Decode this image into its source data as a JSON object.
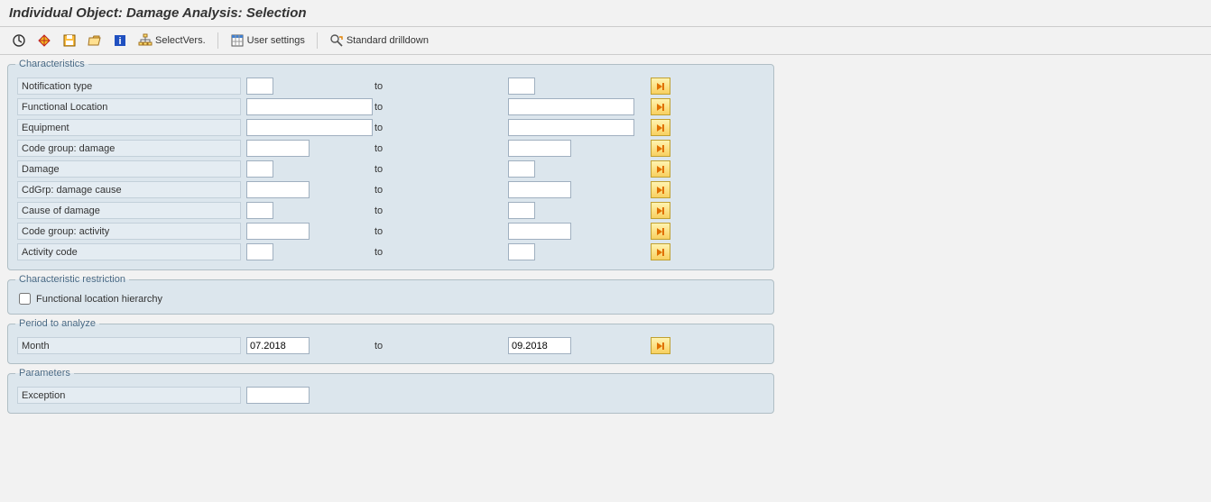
{
  "title": "Individual Object: Damage Analysis: Selection",
  "toolbar": {
    "select_vers": "SelectVers.",
    "user_settings": "User settings",
    "standard_drilldown": "Standard drilldown"
  },
  "panels": {
    "characteristics": {
      "title": "Characteristics",
      "to_label": "to",
      "rows": [
        {
          "label": "Notification type",
          "from": "",
          "to": "",
          "size": "tiny"
        },
        {
          "label": "Functional Location",
          "from": "",
          "to": "",
          "size": "md"
        },
        {
          "label": "Equipment",
          "from": "",
          "to": "",
          "size": "md"
        },
        {
          "label": "Code group: damage",
          "from": "",
          "to": "",
          "size": "sm"
        },
        {
          "label": "Damage",
          "from": "",
          "to": "",
          "size": "tiny"
        },
        {
          "label": "CdGrp: damage cause",
          "from": "",
          "to": "",
          "size": "sm"
        },
        {
          "label": "Cause of damage",
          "from": "",
          "to": "",
          "size": "tiny"
        },
        {
          "label": "Code group: activity",
          "from": "",
          "to": "",
          "size": "sm"
        },
        {
          "label": "Activity code",
          "from": "",
          "to": "",
          "size": "tiny"
        }
      ]
    },
    "restriction": {
      "title": "Characteristic restriction",
      "checkbox_label": "Functional location hierarchy"
    },
    "period": {
      "title": "Period to analyze",
      "to_label": "to",
      "label": "Month",
      "from": "07.2018",
      "to": "09.2018"
    },
    "parameters": {
      "title": "Parameters",
      "label": "Exception",
      "value": ""
    }
  }
}
